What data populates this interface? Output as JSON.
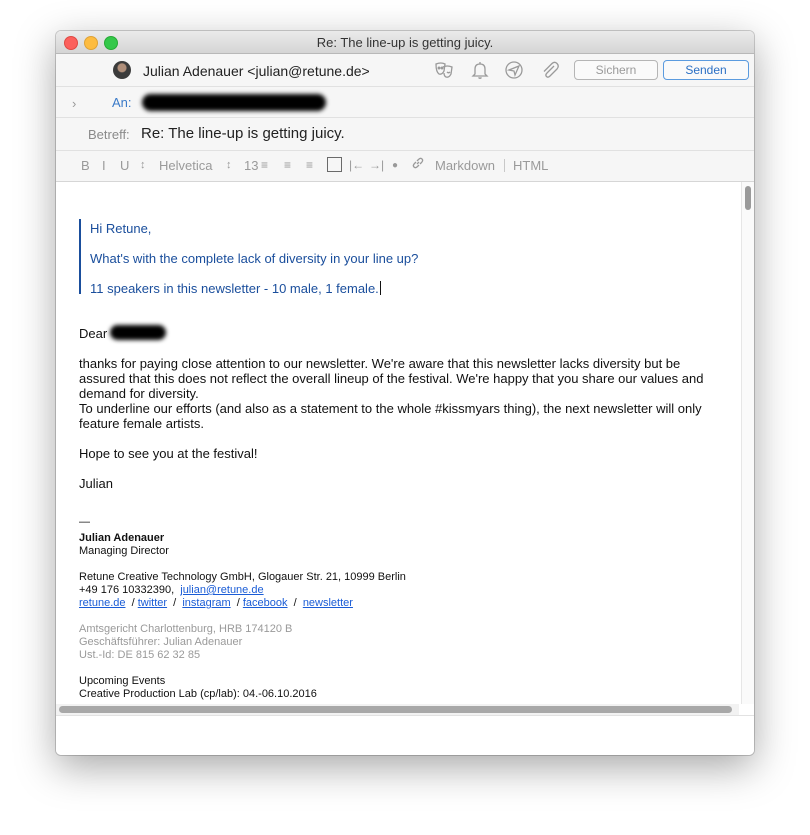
{
  "window": {
    "title": "Re: The line-up is getting juicy."
  },
  "header": {
    "from": "Julian Adenauer <julian@retune.de>",
    "buttons": {
      "save": "Sichern",
      "send": "Senden"
    },
    "to_label": "An:",
    "subject_label": "Betreff:",
    "subject": "Re: The line-up is getting juicy."
  },
  "format_bar": {
    "bold": "B",
    "italic": "I",
    "underline": "U",
    "font": "Helvetica",
    "size": "13",
    "markdown": "Markdown",
    "html": "HTML"
  },
  "quote": {
    "line1": "Hi Retune,",
    "line2": "What's with the complete lack of diversity in your line up?",
    "line3": "11 speakers in this newsletter - 10 male, 1 female."
  },
  "body": {
    "greeting": "Dear",
    "p1a": "thanks for paying close attention to our newsletter. We're aware that this newsletter lacks diversity but be",
    "p1b": "assured that this does not reflect the overall lineup of the festival. We're happy that you share our values and",
    "p1c": "demand for diversity.",
    "p1d": "To underline our efforts (and also as a statement to the whole #kissmyars thing), the next newsletter will only",
    "p1e": "feature female artists.",
    "p2": "Hope to see you at the festival!",
    "p3": "Julian"
  },
  "signature": {
    "dash": "—",
    "name": "Julian Adenauer",
    "role": "Managing Director",
    "address": "Retune Creative Technology GmbH, Glogauer Str. 21, 10999 Berlin",
    "phone": "+49 176 10332390,",
    "email": "julian@retune.de",
    "links": {
      "site": "retune.de",
      "twitter": "twitter",
      "instagram": "instagram",
      "facebook": "facebook",
      "newsletter": "newsletter"
    },
    "legal1": "Amtsgericht Charlottenburg, HRB 174120 B",
    "legal2": "Geschäftsführer: Julian Adenauer",
    "legal3": "Ust.-Id: DE 815 62 32 85",
    "events_title": "Upcoming Events",
    "event1": "Creative Production Lab (cp/lab): 04.-06.10.2016"
  },
  "icons": {
    "header": [
      "theater-masks-icon",
      "bell-icon",
      "send-later-icon",
      "paperclip-icon"
    ],
    "format": [
      "align-left-icon",
      "align-center-icon",
      "align-right-icon",
      "quote-box-icon",
      "outdent-icon",
      "indent-icon",
      "bullet-list-icon",
      "link-icon"
    ]
  },
  "colors": {
    "accent": "#2a6fc4",
    "quote": "#1a4e9c",
    "link": "#1a5cd6"
  }
}
